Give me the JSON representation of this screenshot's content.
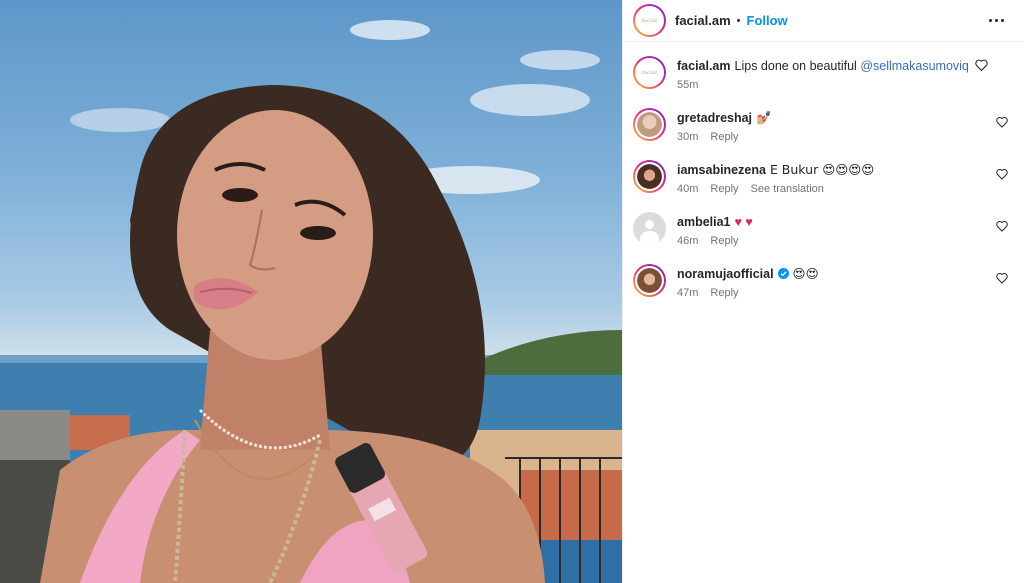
{
  "post": {
    "image_alt": "Selfie of a woman with glossy pink lips holding a pink lip gloss bottle, sea and hills in background"
  },
  "header": {
    "username": "facial.am",
    "separator": "•",
    "follow_label": "Follow",
    "avatar_brand_text": "facial"
  },
  "caption": {
    "username": "facial.am",
    "text": "Lips done on beautiful ",
    "mention": "@sellmakasumoviq",
    "time": "55m"
  },
  "comments": [
    {
      "username": "gretadreshaj",
      "text": "💅🏼",
      "time": "30m",
      "reply_label": "Reply",
      "avatar_bg": "#d9b8a0"
    },
    {
      "username": "iamsabinezena",
      "text": "E Bukur 😍😍😍😍",
      "time": "40m",
      "reply_label": "Reply",
      "translate_label": "See translation",
      "avatar_bg": "#5a3a30"
    },
    {
      "username": "ambelia1",
      "text": "♥ ♥",
      "time": "46m",
      "reply_label": "Reply"
    },
    {
      "username": "noramujaofficial",
      "text": "😍😍",
      "time": "47m",
      "reply_label": "Reply",
      "verified": true,
      "avatar_bg": "#b08868"
    }
  ],
  "colors": {
    "accent_blue": "#0095f6",
    "mention_blue": "#3b6bbf",
    "muted": "#737373",
    "heart_red": "#e0245e",
    "verified_blue": "#0095f6"
  },
  "icons": [
    "more-options-icon",
    "heart-outline-icon",
    "verified-badge-icon"
  ]
}
